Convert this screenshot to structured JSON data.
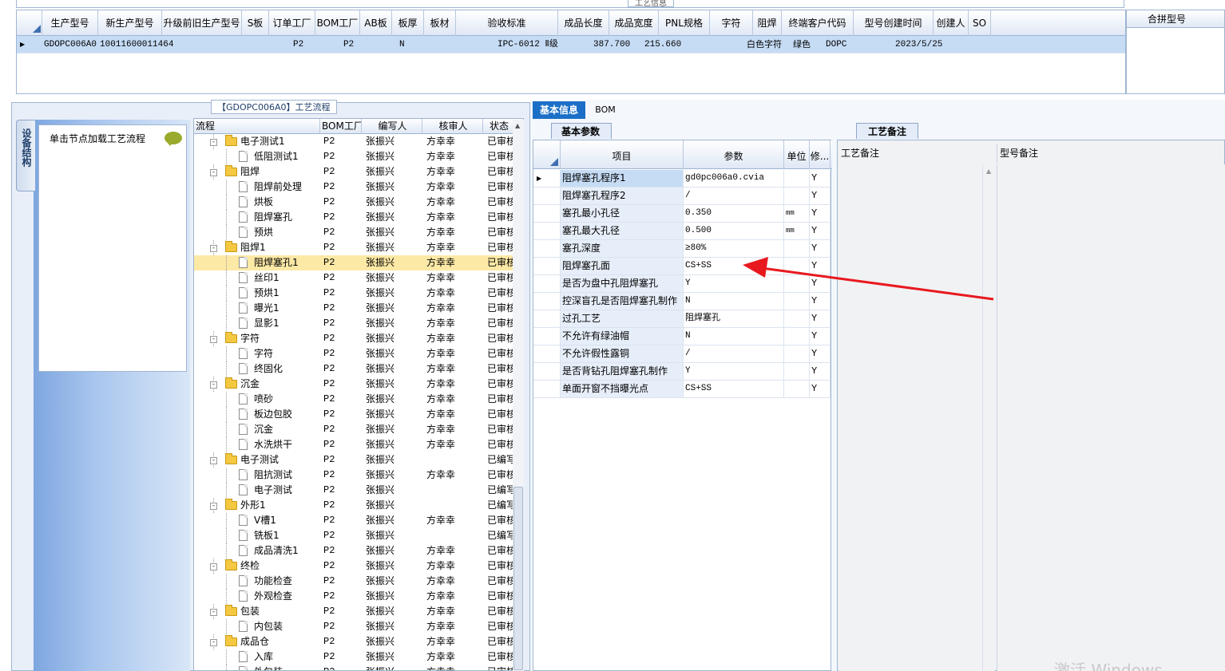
{
  "top_section": {
    "caption": "工艺信息",
    "columns": [
      "生产型号",
      "新生产型号",
      "升级前旧生产型号",
      "S板",
      "订单工厂",
      "BOM工厂",
      "AB板",
      "板厚",
      "板材",
      "验收标准",
      "成品长度",
      "成品宽度",
      "PNL规格",
      "字符",
      "阻焊",
      "终端客户代码",
      "型号创建时间",
      "创建人",
      "SO"
    ],
    "row": {
      "prod_model": "GDOPC006A0",
      "new_prod_model": "10011600011464",
      "order_factory": "P2",
      "bom_factory": "P2",
      "ab": "N",
      "standard": "IPC-6012 Ⅱ级",
      "length": "387.700",
      "width": "215.660",
      "character": "白色字符",
      "solder_mask": "绿色",
      "customer_code": "DOPC",
      "created": "2023/5/25"
    },
    "merge_header": "合拼型号"
  },
  "left_panel": {
    "device_tab": "设备结构",
    "hint": "单击节点加载工艺流程"
  },
  "flow": {
    "title": "【GDOPC006A0】工艺流程",
    "columns": [
      "流程",
      "BOM工厂",
      "编写人",
      "核审人",
      "状态"
    ],
    "rows": [
      {
        "name": "电子测试1",
        "level": 0,
        "bom": "P2",
        "writer": "张振兴",
        "reviewer": "方幸幸",
        "status": "已审核"
      },
      {
        "name": "低阻测试1",
        "level": 1,
        "bom": "P2",
        "writer": "张振兴",
        "reviewer": "方幸幸",
        "status": "已审核"
      },
      {
        "name": "阻焊",
        "level": 0,
        "bom": "P2",
        "writer": "张振兴",
        "reviewer": "方幸幸",
        "status": "已审核"
      },
      {
        "name": "阻焊前处理",
        "level": 1,
        "bom": "P2",
        "writer": "张振兴",
        "reviewer": "方幸幸",
        "status": "已审核"
      },
      {
        "name": "烘板",
        "level": 1,
        "bom": "P2",
        "writer": "张振兴",
        "reviewer": "方幸幸",
        "status": "已审核"
      },
      {
        "name": "阻焊塞孔",
        "level": 1,
        "bom": "P2",
        "writer": "张振兴",
        "reviewer": "方幸幸",
        "status": "已审核"
      },
      {
        "name": "预烘",
        "level": 1,
        "bom": "P2",
        "writer": "张振兴",
        "reviewer": "方幸幸",
        "status": "已审核"
      },
      {
        "name": "阻焊1",
        "level": 0,
        "bom": "P2",
        "writer": "张振兴",
        "reviewer": "方幸幸",
        "status": "已审核"
      },
      {
        "name": "阻焊塞孔1",
        "level": 1,
        "bom": "P2",
        "writer": "张振兴",
        "reviewer": "方幸幸",
        "status": "已审核",
        "selected": true
      },
      {
        "name": "丝印1",
        "level": 1,
        "bom": "P2",
        "writer": "张振兴",
        "reviewer": "方幸幸",
        "status": "已审核"
      },
      {
        "name": "预烘1",
        "level": 1,
        "bom": "P2",
        "writer": "张振兴",
        "reviewer": "方幸幸",
        "status": "已审核"
      },
      {
        "name": "曝光1",
        "level": 1,
        "bom": "P2",
        "writer": "张振兴",
        "reviewer": "方幸幸",
        "status": "已审核"
      },
      {
        "name": "显影1",
        "level": 1,
        "bom": "P2",
        "writer": "张振兴",
        "reviewer": "方幸幸",
        "status": "已审核"
      },
      {
        "name": "字符",
        "level": 0,
        "bom": "P2",
        "writer": "张振兴",
        "reviewer": "方幸幸",
        "status": "已审核"
      },
      {
        "name": "字符",
        "level": 1,
        "bom": "P2",
        "writer": "张振兴",
        "reviewer": "方幸幸",
        "status": "已审核"
      },
      {
        "name": "终固化",
        "level": 1,
        "bom": "P2",
        "writer": "张振兴",
        "reviewer": "方幸幸",
        "status": "已审核"
      },
      {
        "name": "沉金",
        "level": 0,
        "bom": "P2",
        "writer": "张振兴",
        "reviewer": "方幸幸",
        "status": "已审核"
      },
      {
        "name": "喷砂",
        "level": 1,
        "bom": "P2",
        "writer": "张振兴",
        "reviewer": "方幸幸",
        "status": "已审核"
      },
      {
        "name": "板边包胶",
        "level": 1,
        "bom": "P2",
        "writer": "张振兴",
        "reviewer": "方幸幸",
        "status": "已审核"
      },
      {
        "name": "沉金",
        "level": 1,
        "bom": "P2",
        "writer": "张振兴",
        "reviewer": "方幸幸",
        "status": "已审核"
      },
      {
        "name": "水洗烘干",
        "level": 1,
        "bom": "P2",
        "writer": "张振兴",
        "reviewer": "方幸幸",
        "status": "已审核"
      },
      {
        "name": "电子测试",
        "level": 0,
        "bom": "P2",
        "writer": "张振兴",
        "reviewer": "",
        "status": "已编写"
      },
      {
        "name": "阻抗测试",
        "level": 1,
        "bom": "P2",
        "writer": "张振兴",
        "reviewer": "方幸幸",
        "status": "已审核"
      },
      {
        "name": "电子测试",
        "level": 1,
        "bom": "P2",
        "writer": "张振兴",
        "reviewer": "",
        "status": "已编写"
      },
      {
        "name": "外形1",
        "level": 0,
        "bom": "P2",
        "writer": "张振兴",
        "reviewer": "",
        "status": "已编写"
      },
      {
        "name": "V槽1",
        "level": 1,
        "bom": "P2",
        "writer": "张振兴",
        "reviewer": "方幸幸",
        "status": "已审核"
      },
      {
        "name": "铣板1",
        "level": 1,
        "bom": "P2",
        "writer": "张振兴",
        "reviewer": "",
        "status": "已编写"
      },
      {
        "name": "成品清洗1",
        "level": 1,
        "bom": "P2",
        "writer": "张振兴",
        "reviewer": "方幸幸",
        "status": "已审核"
      },
      {
        "name": "终检",
        "level": 0,
        "bom": "P2",
        "writer": "张振兴",
        "reviewer": "方幸幸",
        "status": "已审核"
      },
      {
        "name": "功能检查",
        "level": 1,
        "bom": "P2",
        "writer": "张振兴",
        "reviewer": "方幸幸",
        "status": "已审核"
      },
      {
        "name": "外观检查",
        "level": 1,
        "bom": "P2",
        "writer": "张振兴",
        "reviewer": "方幸幸",
        "status": "已审核"
      },
      {
        "name": "包装",
        "level": 0,
        "bom": "P2",
        "writer": "张振兴",
        "reviewer": "方幸幸",
        "status": "已审核"
      },
      {
        "name": "内包装",
        "level": 1,
        "bom": "P2",
        "writer": "张振兴",
        "reviewer": "方幸幸",
        "status": "已审核"
      },
      {
        "name": "成品仓",
        "level": 0,
        "bom": "P2",
        "writer": "张振兴",
        "reviewer": "方幸幸",
        "status": "已审核"
      },
      {
        "name": "入库",
        "level": 1,
        "bom": "P2",
        "writer": "张振兴",
        "reviewer": "方幸幸",
        "status": "已审核"
      },
      {
        "name": "外包装",
        "level": 1,
        "bom": "P2",
        "writer": "张振兴",
        "reviewer": "方幸幸",
        "status": "已审核"
      }
    ]
  },
  "right_tabs": {
    "basic": "基本信息",
    "bom": "BOM"
  },
  "params": {
    "tab": "基本参数",
    "columns": [
      "项目",
      "参数",
      "单位",
      "修..."
    ],
    "rows": [
      {
        "item": "阻焊塞孔程序1",
        "value": "gd0pc006a0.cvia",
        "unit": "",
        "flag": "Y"
      },
      {
        "item": "阻焊塞孔程序2",
        "value": "/",
        "unit": "",
        "flag": "Y"
      },
      {
        "item": "塞孔最小孔径",
        "value": "0.350",
        "unit": "mm",
        "flag": "Y"
      },
      {
        "item": "塞孔最大孔径",
        "value": "0.500",
        "unit": "mm",
        "flag": "Y"
      },
      {
        "item": "塞孔深度",
        "value": "≥80%",
        "unit": "",
        "flag": "Y"
      },
      {
        "item": "阻焊塞孔面",
        "value": "CS+SS",
        "unit": "",
        "flag": "Y"
      },
      {
        "item": "是否为盘中孔阻焊塞孔",
        "value": "Y",
        "unit": "",
        "flag": "Y"
      },
      {
        "item": "控深盲孔是否阻焊塞孔制作",
        "value": "N",
        "unit": "",
        "flag": "Y"
      },
      {
        "item": "过孔工艺",
        "value": "阻焊塞孔",
        "unit": "",
        "flag": "Y"
      },
      {
        "item": "不允许有绿油帽",
        "value": "N",
        "unit": "",
        "flag": "Y"
      },
      {
        "item": "不允许假性露铜",
        "value": "/",
        "unit": "",
        "flag": "Y"
      },
      {
        "item": "是否背钻孔阻焊塞孔制作",
        "value": "Y",
        "unit": "",
        "flag": "Y"
      },
      {
        "item": "单面开窗不挡曝光点",
        "value": "CS+SS",
        "unit": "",
        "flag": "Y"
      }
    ]
  },
  "notes": {
    "tab": "工艺备注",
    "process_note": "工艺备注",
    "model_note": "型号备注"
  },
  "watermark": "激活 Windows",
  "colors": {
    "accent": "#1b6fc7",
    "selection": "#c6dcf5",
    "tree_selection": "#fde9a6",
    "arrow": "#e8191e"
  }
}
